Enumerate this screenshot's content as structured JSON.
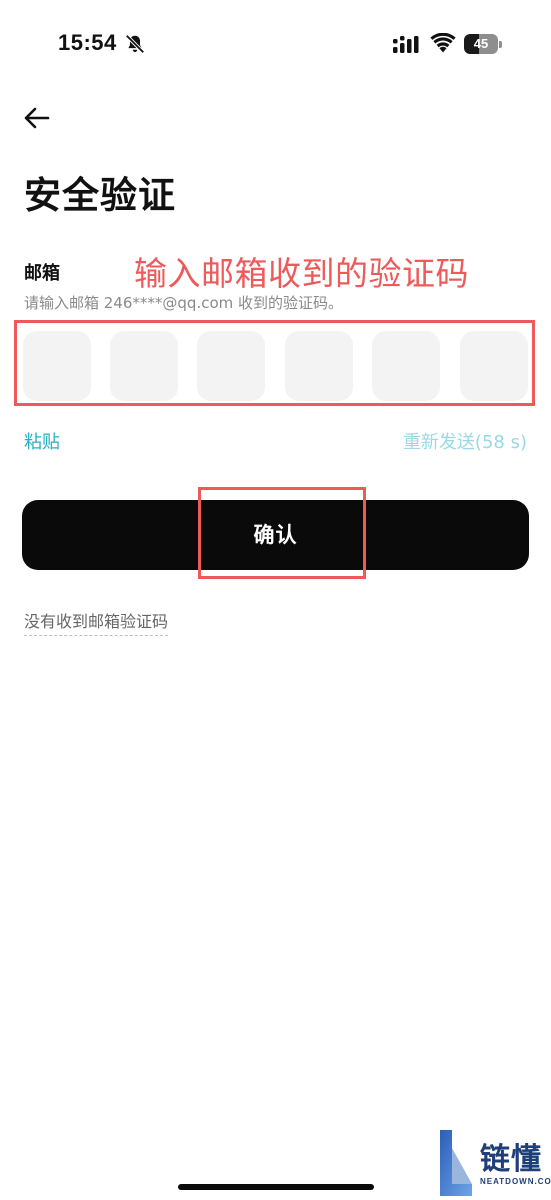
{
  "status_bar": {
    "time": "15:54",
    "battery_level": "45",
    "battery_fraction": 0.45,
    "icons": [
      "bell-off-icon",
      "cellular-signal-icon",
      "wifi-icon",
      "battery-icon"
    ]
  },
  "header": {
    "back_icon": "arrow-left-icon"
  },
  "page": {
    "title": "安全验证",
    "field_label": "邮箱",
    "hint": "请输入邮箱 246****@qq.com 收到的验证码。",
    "code_cells": [
      "",
      "",
      "",
      "",
      "",
      ""
    ],
    "paste_label": "粘贴",
    "resend_label": "重新发送(58 s)",
    "confirm_label": "确认",
    "no_code_label": "没有收到邮箱验证码"
  },
  "annotation": {
    "text": "输入邮箱收到的验证码",
    "color": "#ee5a5a"
  },
  "watermark": {
    "cn": "链懂",
    "en": "NEATDOWN.COM"
  },
  "colors": {
    "accent": "#26b0c6",
    "accent_disabled": "#9ad9e3",
    "button_bg": "#0a0a0a",
    "cell_bg": "#f3f3f3"
  }
}
